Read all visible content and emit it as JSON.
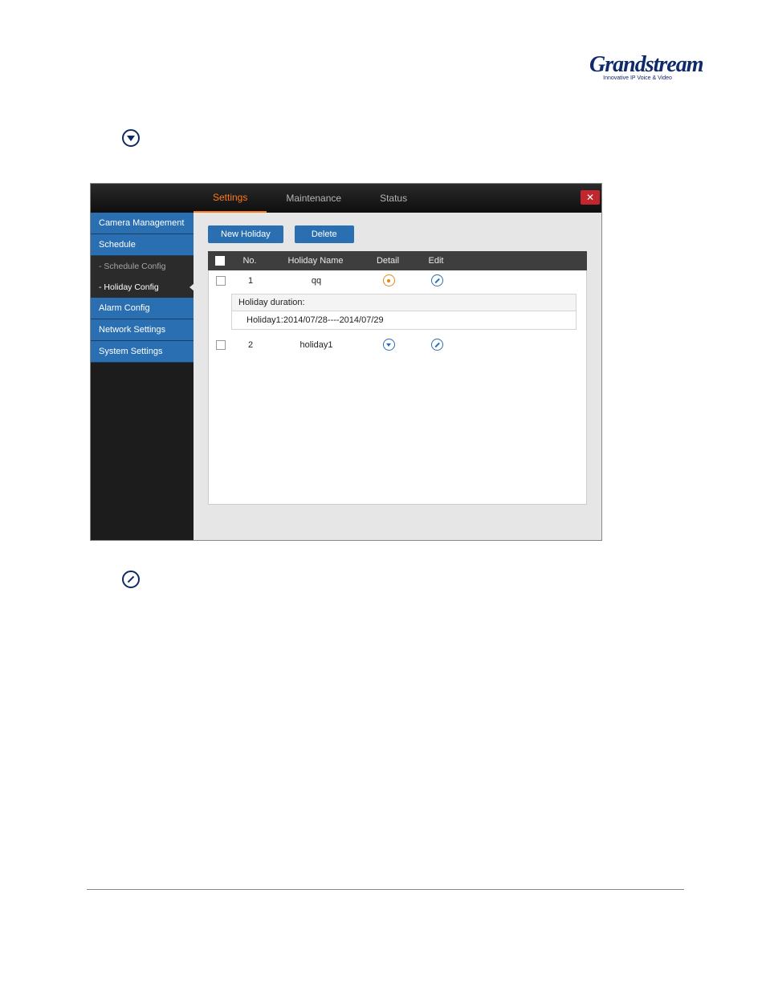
{
  "logo": {
    "brand": "Grandstream",
    "tagline": "Innovative IP Voice & Video"
  },
  "top_tabs": {
    "settings": "Settings",
    "maintenance": "Maintenance",
    "status": "Status"
  },
  "close_label": "✕",
  "sidebar": {
    "camera": "Camera Management",
    "schedule": "Schedule",
    "schedule_config": "- Schedule Config",
    "holiday_config": "- Holiday Config",
    "alarm": "Alarm Config",
    "network": "Network Settings",
    "system": "System Settings"
  },
  "buttons": {
    "new_holiday": "New Holiday",
    "delete": "Delete"
  },
  "columns": {
    "no": "No.",
    "name": "Holiday Name",
    "detail": "Detail",
    "edit": "Edit"
  },
  "rows": [
    {
      "no": "1",
      "name": "qq"
    },
    {
      "no": "2",
      "name": "holiday1"
    }
  ],
  "detail_panel": {
    "label": "Holiday duration:",
    "value": "Holiday1:2014/07/28----2014/07/29"
  }
}
